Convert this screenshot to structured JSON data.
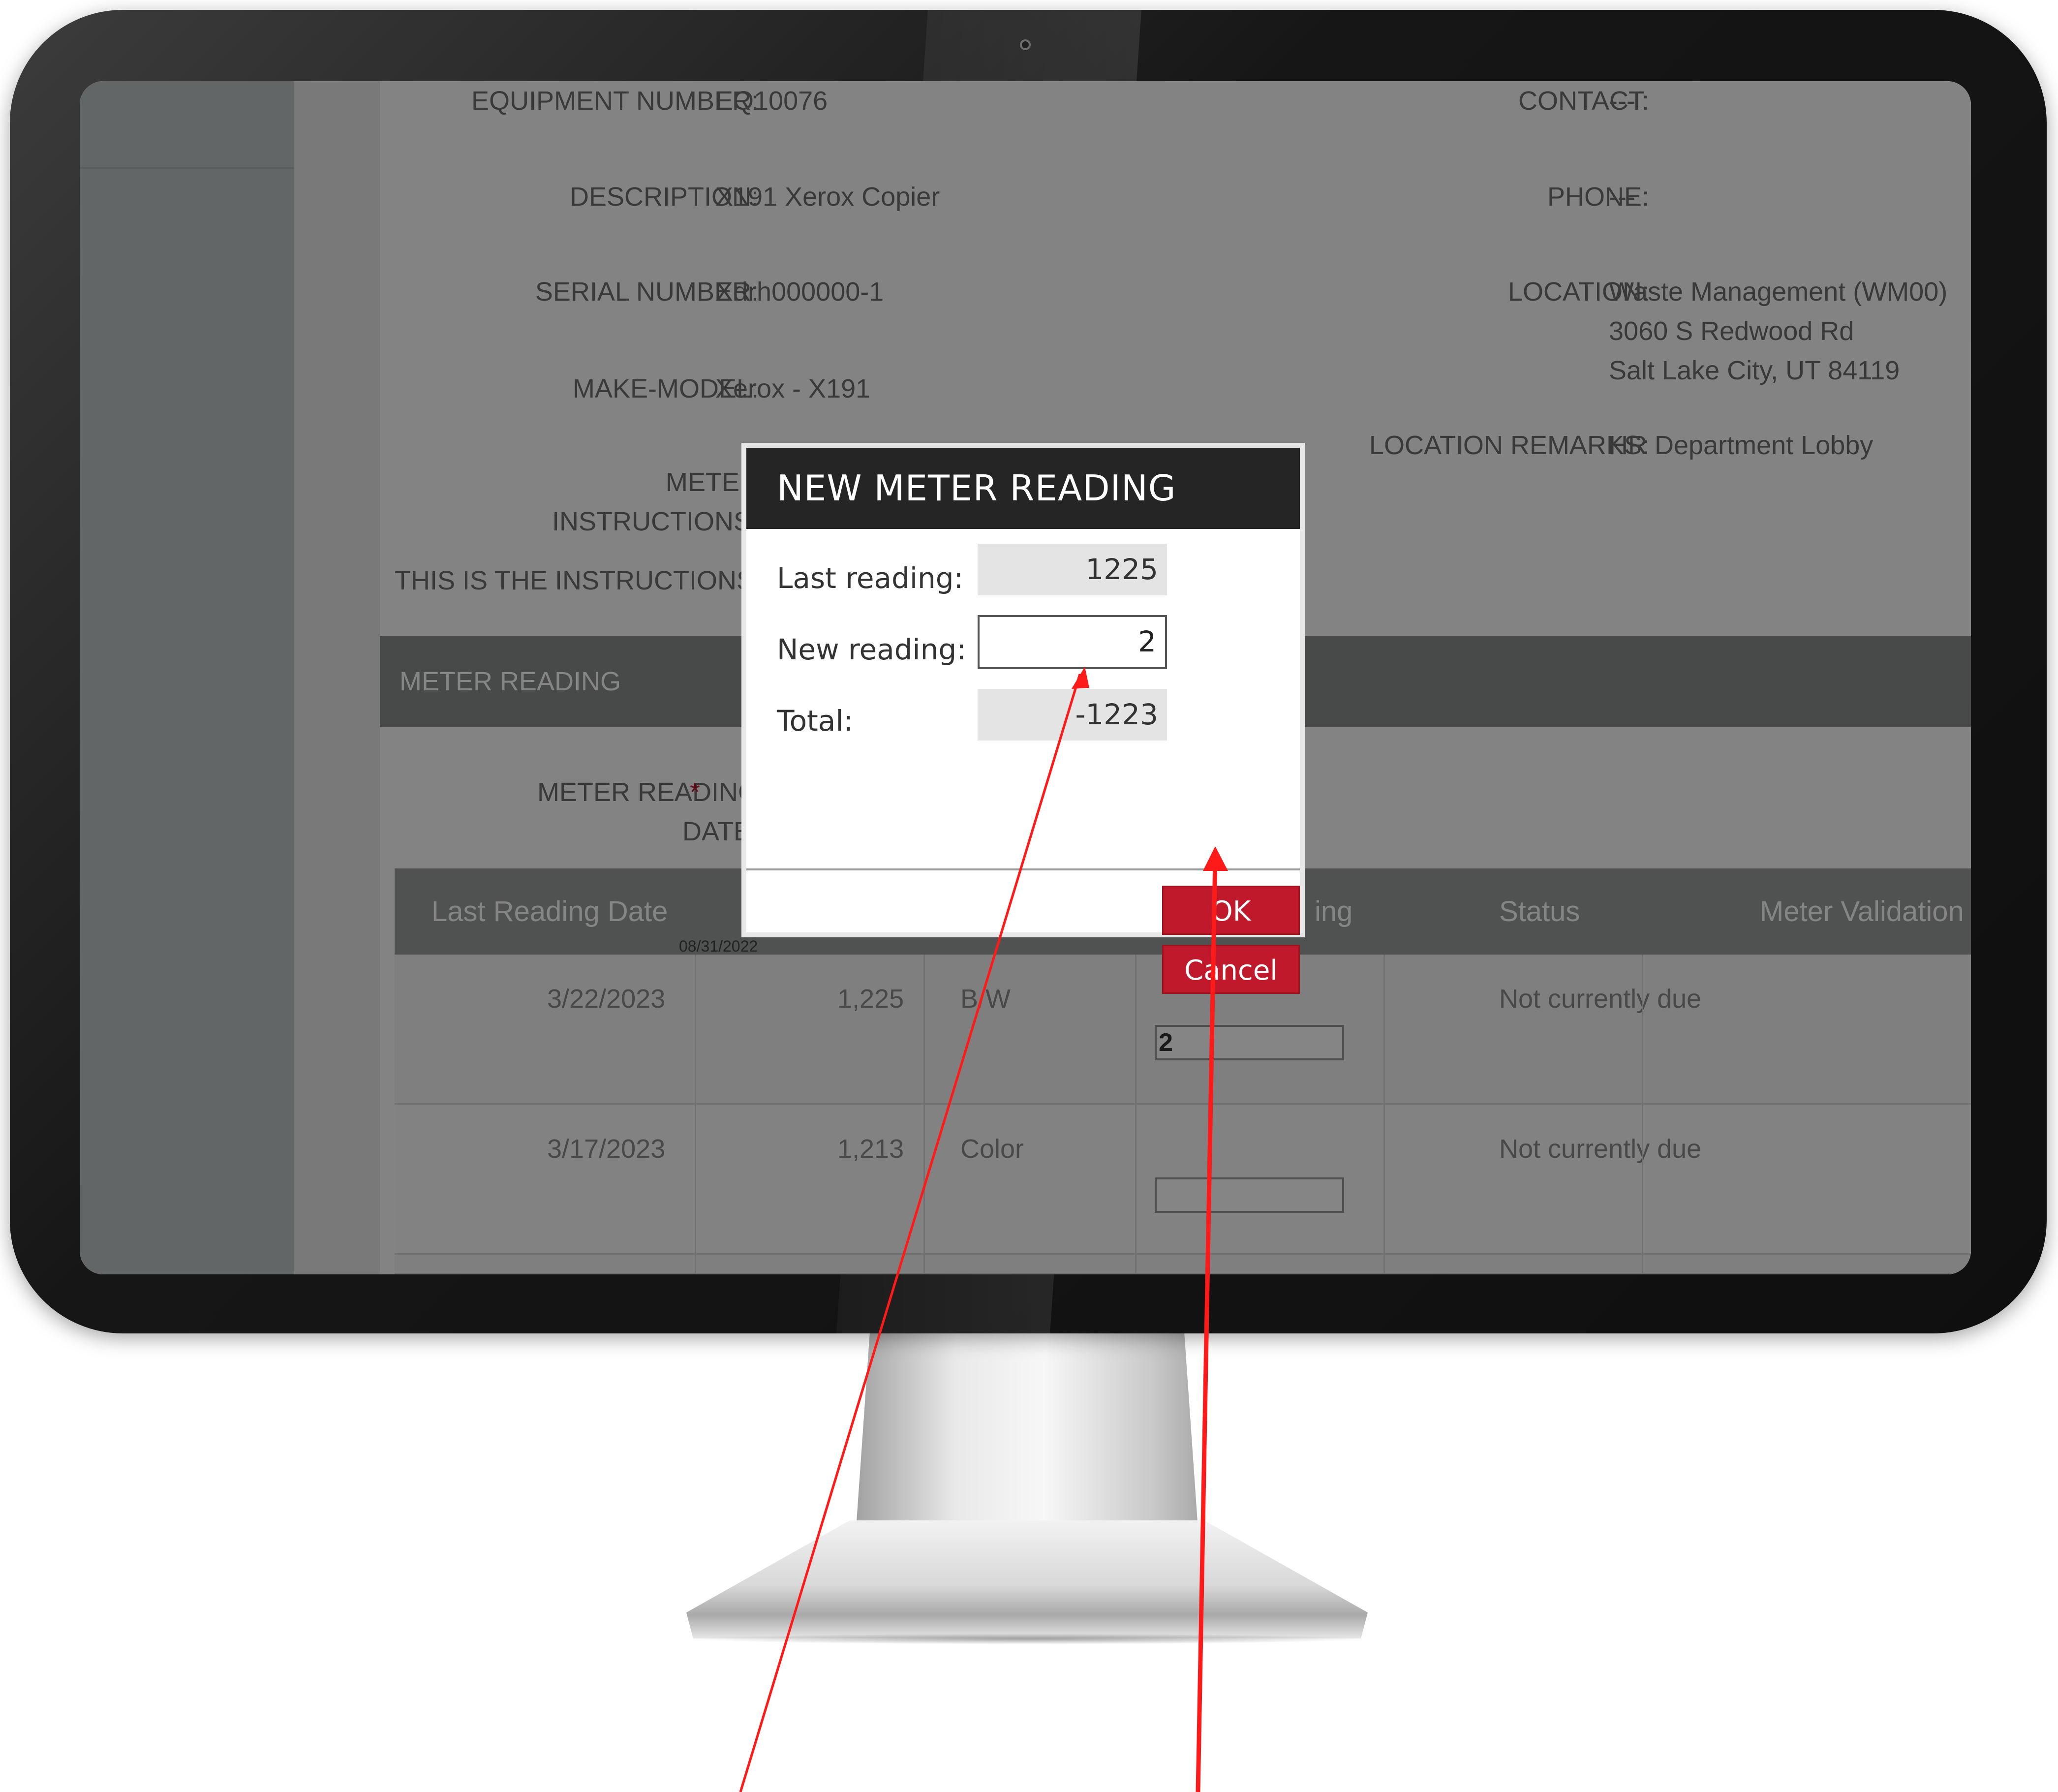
{
  "details": {
    "equipment_number_label": "EQUIPMENT NUMBER:",
    "equipment_number": "EQ10076",
    "description_label": "DESCRIPTION:",
    "description": "X191 Xerox Copier",
    "serial_number_label": "SERIAL NUMBER:",
    "serial_number": "Xdrh000000-1",
    "make_model_label": "MAKE-MODEL:",
    "make_model": "Xerox - X191",
    "meter_instructions_label_1": "METER",
    "meter_instructions_label_2": "INSTRUCTIONS:",
    "instructions_text": "THIS IS THE INSTRUCTIONS",
    "contact_label": "CONTACT:",
    "contact": "---",
    "phone_label": "PHONE:",
    "phone": "---",
    "location_label": "LOCATION:",
    "location_line1": "Waste Management (WM00)",
    "location_line2": "3060 S Redwood Rd",
    "location_line3": "Salt Lake City, UT 84119",
    "location_remarks_label": "LOCATION REMARKS:",
    "location_remarks": "HR Department Lobby"
  },
  "meter_section": {
    "title": "METER READING",
    "date_label_1": "METER READING",
    "date_label_2": "DATE:",
    "required_mark": "*",
    "date_tooltip": "08/31/2022"
  },
  "table": {
    "headers": [
      "Last Reading Date",
      "Status",
      "Meter Validation Mes"
    ],
    "header_partial": "ing",
    "rows": [
      {
        "date": "3/22/2023",
        "reading": "1,225",
        "type": "B/W",
        "new_value": "2",
        "status": "Not currently due"
      },
      {
        "date": "3/17/2023",
        "reading": "1,213",
        "type": "Color",
        "new_value": "",
        "status": "Not currently due"
      }
    ]
  },
  "modal": {
    "title": "NEW METER READING",
    "last_reading_label": "Last reading:",
    "last_reading": "1225",
    "new_reading_label": "New reading:",
    "new_reading": "2",
    "total_label": "Total:",
    "total": "-1223",
    "ok_label": "OK",
    "cancel_label": "Cancel"
  },
  "colors": {
    "accent": "#c0192c",
    "modal_header": "#252525",
    "annotation_arrow": "#ff1a1a"
  }
}
